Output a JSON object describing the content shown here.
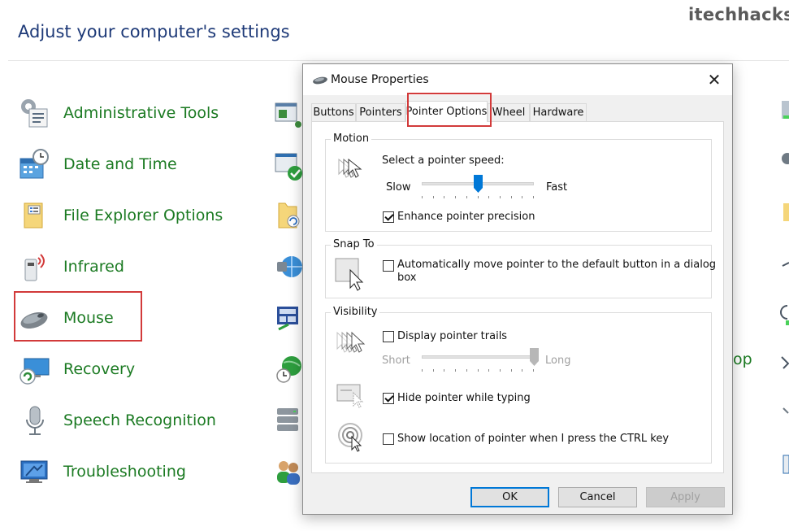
{
  "watermark": "itechhacks",
  "control_panel": {
    "heading": "Adjust your computer's settings",
    "items": [
      {
        "label": "Administrative Tools",
        "icon": "admin-tools-icon"
      },
      {
        "label": "Date and Time",
        "icon": "date-time-icon"
      },
      {
        "label": "File Explorer Options",
        "icon": "file-explorer-options-icon"
      },
      {
        "label": "Infrared",
        "icon": "infrared-icon"
      },
      {
        "label": "Mouse",
        "icon": "mouse-icon"
      },
      {
        "label": "Recovery",
        "icon": "recovery-icon"
      },
      {
        "label": "Speech Recognition",
        "icon": "microphone-icon"
      },
      {
        "label": "Troubleshooting",
        "icon": "troubleshooting-icon"
      }
    ],
    "partial_label": "op"
  },
  "dialog": {
    "title": "Mouse Properties",
    "close_glyph": "✕",
    "tabs": [
      "Buttons",
      "Pointers",
      "Pointer Options",
      "Wheel",
      "Hardware"
    ],
    "active_tab": "Pointer Options",
    "motion": {
      "legend": "Motion",
      "prompt": "Select a pointer speed:",
      "slow": "Slow",
      "fast": "Fast",
      "speed_fraction": 0.5,
      "enhance_label": "Enhance pointer precision",
      "enhance_checked": true
    },
    "snap_to": {
      "legend": "Snap To",
      "label_line1": "Automatically move pointer to the default button in a dialog",
      "label_line2": "box",
      "checked": false
    },
    "visibility": {
      "legend": "Visibility",
      "trails_label": "Display pointer trails",
      "trails_checked": false,
      "short": "Short",
      "long": "Long",
      "trail_length_fraction": 1.0,
      "hide_label": "Hide pointer while typing",
      "hide_checked": true,
      "ctrl_label": "Show location of pointer when I press the CTRL key",
      "ctrl_checked": false
    },
    "buttons": {
      "ok": "OK",
      "cancel": "Cancel",
      "apply": "Apply"
    }
  },
  "colors": {
    "link_green": "#1b7a22",
    "heading_blue": "#1e3a78",
    "highlight_red": "#d23a3a",
    "accent_blue": "#0078d7"
  }
}
